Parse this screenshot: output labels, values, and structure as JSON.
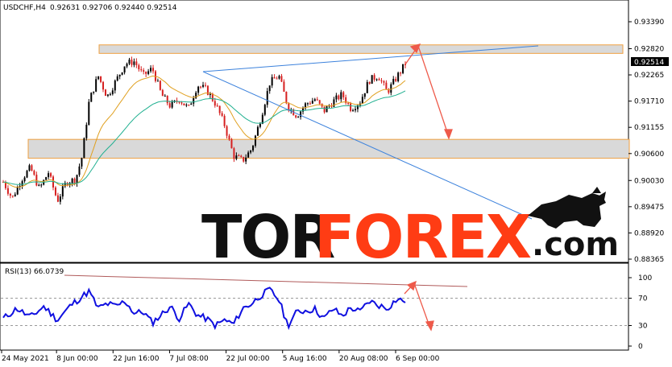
{
  "header": {
    "symbol": "USDCHF,H4",
    "ohlc": "0.92631 0.92706 0.92440 0.92514"
  },
  "watermark": {
    "part1": "TOR",
    "part2": "FOREX",
    "part3": ".com"
  },
  "colors": {
    "bull": "#000000",
    "bear": "#d62020",
    "ma_fast": "#e0a020",
    "ma_slow": "#20b090",
    "trend": "#3c82dc",
    "arrow": "#ee5a4a",
    "rsi": "#1010e0",
    "zone": "#d9d9d9",
    "zone_border": "#f0a040"
  },
  "chart_data": [
    {
      "type": "candlestick",
      "title": "USDCHF,H4",
      "price_axis_ticks": [
        "0.93390",
        "0.92820",
        "0.92265",
        "0.91710",
        "0.91155",
        "0.90600",
        "0.90030",
        "0.89475",
        "0.88920",
        "0.88365"
      ],
      "current_price": "0.92514",
      "ylim": [
        0.88365,
        0.9339
      ],
      "x_tick_labels": [
        "24 May 2021",
        "8 Jun 00:00",
        "22 Jun 16:00",
        "7 Jul 08:00",
        "22 Jul 00:00",
        "5 Aug 16:00",
        "20 Aug 08:00",
        "6 Sep 00:00"
      ],
      "approx_close_path": [
        [
          0,
          0.9
        ],
        [
          4,
          0.8965
        ],
        [
          8,
          0.9005
        ],
        [
          12,
          0.903
        ],
        [
          16,
          0.8985
        ],
        [
          20,
          0.902
        ],
        [
          24,
          0.896
        ],
        [
          28,
          0.9
        ],
        [
          32,
          0.9005
        ],
        [
          35,
          0.9055
        ],
        [
          38,
          0.917
        ],
        [
          42,
          0.9225
        ],
        [
          46,
          0.918
        ],
        [
          50,
          0.9215
        ],
        [
          54,
          0.925
        ],
        [
          58,
          0.9255
        ],
        [
          62,
          0.9225
        ],
        [
          66,
          0.924
        ],
        [
          70,
          0.9185
        ],
        [
          74,
          0.916
        ],
        [
          78,
          0.9175
        ],
        [
          82,
          0.9155
        ],
        [
          86,
          0.9205
        ],
        [
          90,
          0.9195
        ],
        [
          94,
          0.9165
        ],
        [
          98,
          0.912
        ],
        [
          102,
          0.9055
        ],
        [
          106,
          0.9045
        ],
        [
          110,
          0.907
        ],
        [
          114,
          0.9135
        ],
        [
          118,
          0.921
        ],
        [
          122,
          0.9225
        ],
        [
          126,
          0.916
        ],
        [
          130,
          0.914
        ],
        [
          134,
          0.9165
        ],
        [
          138,
          0.9175
        ],
        [
          142,
          0.915
        ],
        [
          146,
          0.917
        ],
        [
          150,
          0.9185
        ],
        [
          154,
          0.9155
        ],
        [
          158,
          0.917
        ],
        [
          162,
          0.9215
        ],
        [
          166,
          0.9225
        ],
        [
          170,
          0.919
        ],
        [
          174,
          0.922
        ],
        [
          178,
          0.925
        ]
      ],
      "support_zone": [
        0.905,
        0.909
      ],
      "resistance_zone": [
        0.9272,
        0.929
      ],
      "moving_averages": [
        "fast",
        "slow"
      ]
    },
    {
      "type": "line",
      "title": "RSI(13) 66.0739",
      "ylim": [
        0,
        100
      ],
      "y_ticks": [
        "100",
        "70",
        "30",
        "0"
      ],
      "levels": [
        70,
        30
      ],
      "last_value": 66.0739,
      "approx_path": [
        [
          0,
          40
        ],
        [
          6,
          55
        ],
        [
          12,
          42
        ],
        [
          18,
          58
        ],
        [
          24,
          38
        ],
        [
          30,
          60
        ],
        [
          34,
          70
        ],
        [
          38,
          80
        ],
        [
          42,
          55
        ],
        [
          46,
          62
        ],
        [
          50,
          58
        ],
        [
          54,
          66
        ],
        [
          58,
          48
        ],
        [
          62,
          50
        ],
        [
          66,
          34
        ],
        [
          70,
          46
        ],
        [
          74,
          58
        ],
        [
          78,
          40
        ],
        [
          82,
          62
        ],
        [
          86,
          45
        ],
        [
          90,
          40
        ],
        [
          94,
          30
        ],
        [
          98,
          38
        ],
        [
          102,
          32
        ],
        [
          106,
          55
        ],
        [
          110,
          62
        ],
        [
          114,
          74
        ],
        [
          118,
          82
        ],
        [
          122,
          68
        ],
        [
          126,
          30
        ],
        [
          130,
          50
        ],
        [
          134,
          52
        ],
        [
          138,
          54
        ],
        [
          142,
          40
        ],
        [
          146,
          55
        ],
        [
          150,
          44
        ],
        [
          154,
          56
        ],
        [
          158,
          50
        ],
        [
          162,
          66
        ],
        [
          166,
          60
        ],
        [
          170,
          55
        ],
        [
          174,
          68
        ],
        [
          178,
          66
        ]
      ]
    }
  ]
}
